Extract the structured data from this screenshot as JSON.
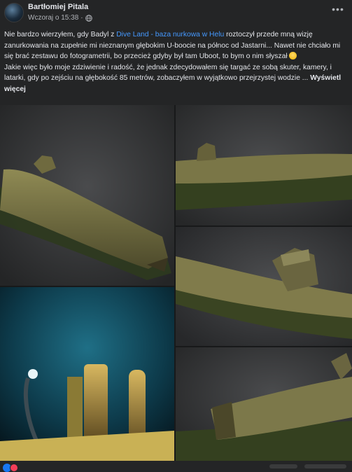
{
  "post": {
    "author": "Bartłomiej Pitala",
    "timestamp": "Wczoraj o 15:38",
    "separator": "·",
    "privacy_icon": "globe-icon",
    "more_icon": "more-options-icon",
    "text": {
      "p1_part1": "Nie bardzo wierzyłem, gdy Badyl z ",
      "link": "Dive Land - baza nurkowa w Helu",
      "p1_part2": " roztoczył przede mną wizję zanurkowania na zupełnie mi nieznanym głębokim U-boocie na północ od Jastarni... Nawet nie chciało mi się brać zestawu do fotogrametrii, bo przecież gdyby był tam Uboot, to bym o nim słyszał ",
      "emoji": "thinking-face-emoji",
      "p2": "Jakie więc było moje zdziwienie i radość, że jednak zdecydowałem się targać ze sobą skuter, kamery, i latarki, gdy po zejściu na głębokość 85 metrów, zobaczyłem w wyjątkowo przejrzystej wodzie ...",
      "see_more": "Wyświetl więcej"
    }
  },
  "photos": [
    {
      "name": "photo-uboat-model-bow"
    },
    {
      "name": "photo-uboat-model-side"
    },
    {
      "name": "photo-uboat-model-conning-tower"
    },
    {
      "name": "photo-underwater-wreck"
    },
    {
      "name": "photo-uboat-model-stern"
    }
  ],
  "reactions": [
    "like-icon",
    "love-icon"
  ],
  "colors": {
    "background": "#242526",
    "text": "#e4e6eb",
    "muted": "#b0b3b8",
    "link": "#4599ff"
  }
}
